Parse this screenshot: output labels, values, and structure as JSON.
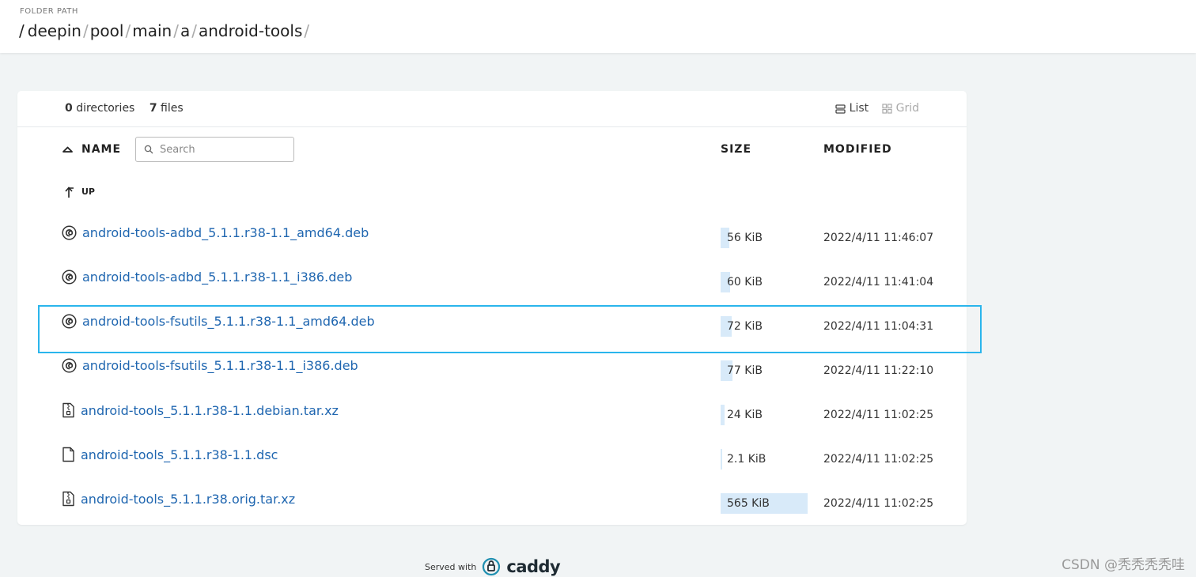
{
  "header": {
    "folder_label": "FOLDER PATH",
    "breadcrumb": [
      "deepin",
      "pool",
      "main",
      "a",
      "android-tools"
    ]
  },
  "summary": {
    "dir_count": "0",
    "dir_label": "directories",
    "file_count": "7",
    "file_label": "files"
  },
  "view": {
    "list_label": "List",
    "grid_label": "Grid"
  },
  "table": {
    "name_header": "NAME",
    "size_header": "SIZE",
    "modified_header": "MODIFIED",
    "search_placeholder": "Search",
    "up_label": "UP",
    "rows": [
      {
        "name": "android-tools-adbd_5.1.1.r38-1.1_amd64.deb",
        "icon": "debian-icon",
        "size": "56 KiB",
        "size_fraction": 0.1,
        "modified": "2022/4/11 11:46:07"
      },
      {
        "name": "android-tools-adbd_5.1.1.r38-1.1_i386.deb",
        "icon": "debian-icon",
        "size": "60 KiB",
        "size_fraction": 0.106,
        "modified": "2022/4/11 11:41:04"
      },
      {
        "name": "android-tools-fsutils_5.1.1.r38-1.1_amd64.deb",
        "icon": "debian-icon",
        "size": "72 KiB",
        "size_fraction": 0.127,
        "modified": "2022/4/11 11:04:31"
      },
      {
        "name": "android-tools-fsutils_5.1.1.r38-1.1_i386.deb",
        "icon": "debian-icon",
        "size": "77 KiB",
        "size_fraction": 0.136,
        "modified": "2022/4/11 11:22:10"
      },
      {
        "name": "android-tools_5.1.1.r38-1.1.debian.tar.xz",
        "icon": "archive-file-icon",
        "size": "24 KiB",
        "size_fraction": 0.042,
        "modified": "2022/4/11 11:02:25"
      },
      {
        "name": "android-tools_5.1.1.r38-1.1.dsc",
        "icon": "file-icon",
        "size": "2.1 KiB",
        "size_fraction": 0.004,
        "modified": "2022/4/11 11:02:25"
      },
      {
        "name": "android-tools_5.1.1.r38.orig.tar.xz",
        "icon": "archive-file-icon",
        "size": "565 KiB",
        "size_fraction": 1.0,
        "modified": "2022/4/11 11:02:25"
      }
    ]
  },
  "footer": {
    "served_with": "Served with",
    "brand": "caddy"
  },
  "watermark": "CSDN @秃秃秃秃哇",
  "colors": {
    "link": "#1f66b0",
    "size_bar": "#d8eaf9",
    "highlight": "#2ab5ec",
    "page_bg": "#f1f4f5"
  }
}
